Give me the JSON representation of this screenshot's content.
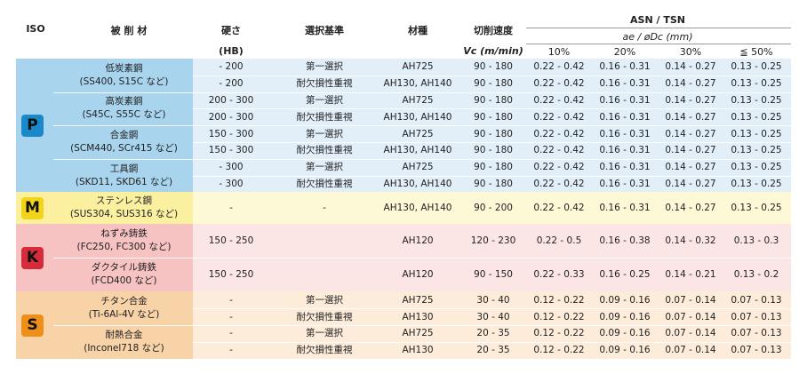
{
  "header": {
    "iso": "ISO",
    "material": "被 削 材",
    "hardness": "硬さ",
    "hardness_unit": "(HB)",
    "criteria": "選択基準",
    "grade": "材種",
    "speed": "切削速度",
    "speed_unit": "Vc (m/min)",
    "series": "ASN / TSN",
    "feed_label": "ae / øDc (mm)",
    "pct": [
      "10%",
      "20%",
      "30%",
      "≦ 50%"
    ]
  },
  "colors": {
    "P": "#a8d4ee",
    "P_light": "#e2eff9",
    "M": "#fbf0a0",
    "M_light": "#fdf8d6",
    "K": "#f7c2c2",
    "K_light": "#fbe5e5",
    "S": "#f8d3a8",
    "S_light": "#fcecd9",
    "P_badge": "#1b88c9",
    "M_badge": "#f2d418",
    "K_badge": "#d52b3a",
    "S_badge": "#ee8f1a"
  },
  "groups": [
    {
      "iso": "P",
      "materials": [
        {
          "name": "低炭素鋼",
          "examples": "(SS400, S15C など)",
          "rows": [
            {
              "hb": "- 200",
              "crit": "第一選択",
              "grade": "AH725",
              "vc": "90 - 180",
              "v10": "0.22 - 0.42",
              "v20": "0.16 - 0.31",
              "v30": "0.14 - 0.27",
              "v50": "0.13 - 0.25"
            },
            {
              "hb": "- 200",
              "crit": "耐欠損性重視",
              "grade": "AH130, AH140",
              "vc": "90 - 180",
              "v10": "0.22 - 0.42",
              "v20": "0.16 - 0.31",
              "v30": "0.14 - 0.27",
              "v50": "0.13 - 0.25"
            }
          ]
        },
        {
          "name": "高炭素鋼",
          "examples": "(S45C, S55C など)",
          "rows": [
            {
              "hb": "200 - 300",
              "crit": "第一選択",
              "grade": "AH725",
              "vc": "90 - 180",
              "v10": "0.22 - 0.42",
              "v20": "0.16 - 0.31",
              "v30": "0.14 - 0.27",
              "v50": "0.13 - 0.25"
            },
            {
              "hb": "200 - 300",
              "crit": "耐欠損性重視",
              "grade": "AH130, AH140",
              "vc": "90 - 180",
              "v10": "0.22 - 0.42",
              "v20": "0.16 - 0.31",
              "v30": "0.14 - 0.27",
              "v50": "0.13 - 0.25"
            }
          ]
        },
        {
          "name": "合金鋼",
          "examples": "(SCM440, SCr415 など)",
          "rows": [
            {
              "hb": "150 - 300",
              "crit": "第一選択",
              "grade": "AH725",
              "vc": "90 - 180",
              "v10": "0.22 - 0.42",
              "v20": "0.16 - 0.31",
              "v30": "0.14 - 0.27",
              "v50": "0.13 - 0.25"
            },
            {
              "hb": "150 - 300",
              "crit": "耐欠損性重視",
              "grade": "AH130, AH140",
              "vc": "90 - 180",
              "v10": "0.22 - 0.42",
              "v20": "0.16 - 0.31",
              "v30": "0.14 - 0.27",
              "v50": "0.13 - 0.25"
            }
          ]
        },
        {
          "name": "工具鋼",
          "examples": "(SKD11, SKD61 など)",
          "rows": [
            {
              "hb": "- 300",
              "crit": "第一選択",
              "grade": "AH725",
              "vc": "90 - 180",
              "v10": "0.22 - 0.42",
              "v20": "0.16 - 0.31",
              "v30": "0.14 - 0.27",
              "v50": "0.13 - 0.25"
            },
            {
              "hb": "- 300",
              "crit": "耐欠損性重視",
              "grade": "AH130, AH140",
              "vc": "90 - 180",
              "v10": "0.22 - 0.42",
              "v20": "0.16 - 0.31",
              "v30": "0.14 - 0.27",
              "v50": "0.13 - 0.25"
            }
          ]
        }
      ]
    },
    {
      "iso": "M",
      "materials": [
        {
          "name": "ステンレス鋼",
          "examples": "(SUS304, SUS316 など)",
          "rows": [
            {
              "hb": "-",
              "crit": "-",
              "grade": "AH130, AH140",
              "vc": "90 - 200",
              "v10": "0.22 - 0.42",
              "v20": "0.16 - 0.31",
              "v30": "0.14 - 0.27",
              "v50": "0.13 - 0.25"
            }
          ]
        }
      ]
    },
    {
      "iso": "K",
      "materials": [
        {
          "name": "ねずみ鋳鉄",
          "examples": "(FC250, FC300 など)",
          "rows": [
            {
              "hb": "150 - 250",
              "crit": "",
              "grade": "AH120",
              "vc": "120 - 230",
              "v10": "0.22 - 0.5",
              "v20": "0.16 - 0.38",
              "v30": "0.14 - 0.32",
              "v50": "0.13 - 0.3"
            }
          ]
        },
        {
          "name": "ダクタイル鋳鉄",
          "examples": "(FCD400 など)",
          "rows": [
            {
              "hb": "150 - 250",
              "crit": "",
              "grade": "AH120",
              "vc": "90 - 150",
              "v10": "0.22 - 0.33",
              "v20": "0.16 - 0.25",
              "v30": "0.14 - 0.21",
              "v50": "0.13 - 0.2"
            }
          ]
        }
      ]
    },
    {
      "iso": "S",
      "materials": [
        {
          "name": "チタン合金",
          "examples": "(Ti-6Al-4V など)",
          "rows": [
            {
              "hb": "-",
              "crit": "第一選択",
              "grade": "AH725",
              "vc": "30 - 40",
              "v10": "0.12 - 0.22",
              "v20": "0.09 - 0.16",
              "v30": "0.07 - 0.14",
              "v50": "0.07 - 0.13"
            },
            {
              "hb": "-",
              "crit": "耐欠損性重視",
              "grade": "AH130",
              "vc": "30 - 40",
              "v10": "0.12 - 0.22",
              "v20": "0.09 - 0.16",
              "v30": "0.07 - 0.14",
              "v50": "0.07 - 0.13"
            }
          ]
        },
        {
          "name": "耐熱合金",
          "examples": "(Inconel718 など)",
          "rows": [
            {
              "hb": "-",
              "crit": "第一選択",
              "grade": "AH725",
              "vc": "20 - 35",
              "v10": "0.12 - 0.22",
              "v20": "0.09 - 0.16",
              "v30": "0.07 - 0.14",
              "v50": "0.07 - 0.13"
            },
            {
              "hb": "-",
              "crit": "耐欠損性重視",
              "grade": "AH130",
              "vc": "20 - 35",
              "v10": "0.12 - 0.22",
              "v20": "0.09 - 0.16",
              "v30": "0.07 - 0.14",
              "v50": "0.07 - 0.13"
            }
          ]
        }
      ]
    }
  ]
}
